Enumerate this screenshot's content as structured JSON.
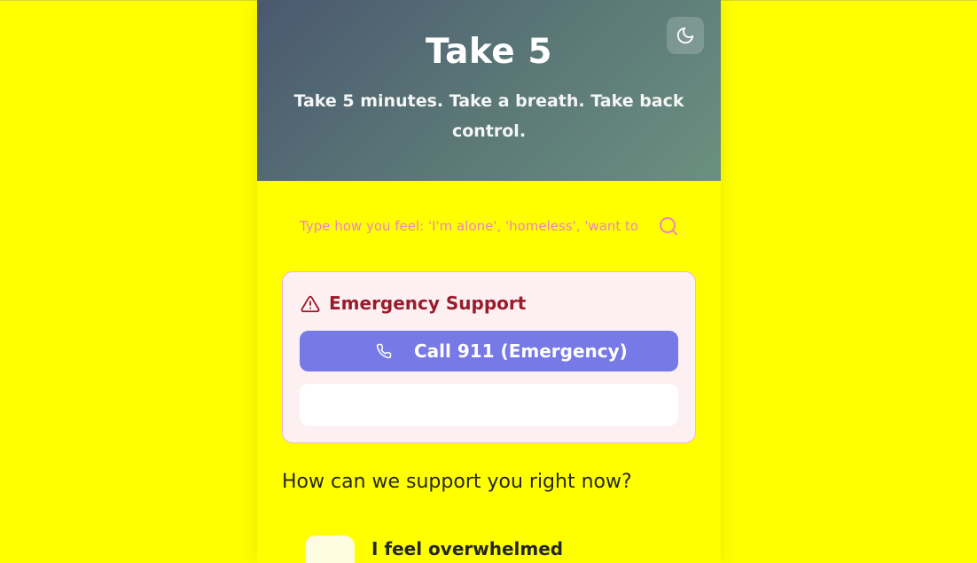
{
  "header": {
    "title": "Take 5",
    "tagline": "Take 5 minutes. Take a breath. Take back control.",
    "theme_toggle_icon": "moon-icon"
  },
  "search": {
    "placeholder": "Type how you feel: 'I'm alone', 'homeless', 'want to",
    "value": "",
    "icon": "search-icon"
  },
  "emergency": {
    "title": "Emergency Support",
    "icon": "alert-triangle-icon",
    "call_button_label": "Call 911 (Emergency)",
    "call_icon": "phone-icon",
    "secondary_button_label": ""
  },
  "support": {
    "heading": "How can we support you right now?",
    "options": [
      {
        "label": "I feel overwhelmed",
        "icon": "option-icon"
      }
    ]
  },
  "colors": {
    "page_background": "#ffff00",
    "header_gradient_start": "#4a5870",
    "header_gradient_end": "#6a9080",
    "emergency_card_background": "#fdf0f2",
    "emergency_title": "#9a1b2a",
    "call_button": "#7779e6",
    "search_placeholder": "#ee86bb"
  }
}
